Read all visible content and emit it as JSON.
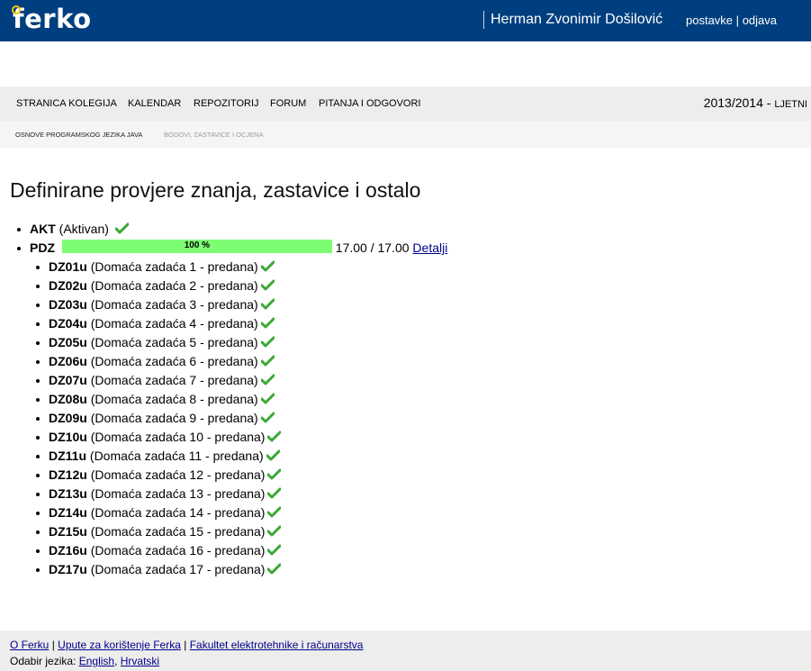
{
  "header": {
    "logo": "ferko",
    "user": "Herman Zvonimir Došilović",
    "settings_link": "postavke",
    "separator": "|",
    "logout_link": "odjava"
  },
  "nav": {
    "items": [
      "STRANICA KOLEGIJA",
      "KALENDAR",
      "REPOZITORIJ",
      "FORUM",
      "PITANJA I ODGOVORI"
    ],
    "term_year": "2013/2014 -",
    "term_semester": "LJETNI"
  },
  "breadcrumb": {
    "course": "OSNOVE PROGRAMSKOG JEZIKA JAVA",
    "current": "BODOVI, ZASTAVICE I OCJENA"
  },
  "page_title": "Definirane provjere znanja, zastavice i ostalo",
  "colors": {
    "header_bg": "#003f7f",
    "progress_fill": "#7dfc74",
    "check": "#3aa835"
  },
  "akt": {
    "code": "AKT",
    "desc": "(Aktivan)",
    "status_icon": "check-icon"
  },
  "pdz": {
    "code": "PDZ",
    "progress_percent": 100,
    "progress_label": "100 %",
    "score": "17.00 / 17.00",
    "details_link": "Detalji"
  },
  "homeworks": [
    {
      "code": "DZ01u",
      "desc": "(Domaća zadaća 1 - predana)"
    },
    {
      "code": "DZ02u",
      "desc": "(Domaća zadaća 2 - predana)"
    },
    {
      "code": "DZ03u",
      "desc": "(Domaća zadaća 3 - predana)"
    },
    {
      "code": "DZ04u",
      "desc": "(Domaća zadaća 4 - predana)"
    },
    {
      "code": "DZ05u",
      "desc": "(Domaća zadaća 5 - predana)"
    },
    {
      "code": "DZ06u",
      "desc": "(Domaća zadaća 6 - predana)"
    },
    {
      "code": "DZ07u",
      "desc": "(Domaća zadaća 7 - predana)"
    },
    {
      "code": "DZ08u",
      "desc": "(Domaća zadaća 8 - predana)"
    },
    {
      "code": "DZ09u",
      "desc": "(Domaća zadaća 9 - predana)"
    },
    {
      "code": "DZ10u",
      "desc": "(Domaća zadaća 10 - predana)"
    },
    {
      "code": "DZ11u",
      "desc": "(Domaća zadaća 11 - predana)"
    },
    {
      "code": "DZ12u",
      "desc": "(Domaća zadaća 12 - predana)"
    },
    {
      "code": "DZ13u",
      "desc": "(Domaća zadaća 13 - predana)"
    },
    {
      "code": "DZ14u",
      "desc": "(Domaća zadaća 14 - predana)"
    },
    {
      "code": "DZ15u",
      "desc": "(Domaća zadaća 15 - predana)"
    },
    {
      "code": "DZ16u",
      "desc": "(Domaća zadaća 16 - predana)"
    },
    {
      "code": "DZ17u",
      "desc": "(Domaća zadaća 17 - predana)"
    }
  ],
  "footer": {
    "links": [
      "O Ferku",
      "Upute za korištenje Ferka",
      "Fakultet elektrotehnike i računarstva"
    ],
    "separator": "|",
    "language_label": "Odabir jezika:",
    "languages": [
      "English",
      "Hrvatski"
    ],
    "language_separator": ","
  }
}
